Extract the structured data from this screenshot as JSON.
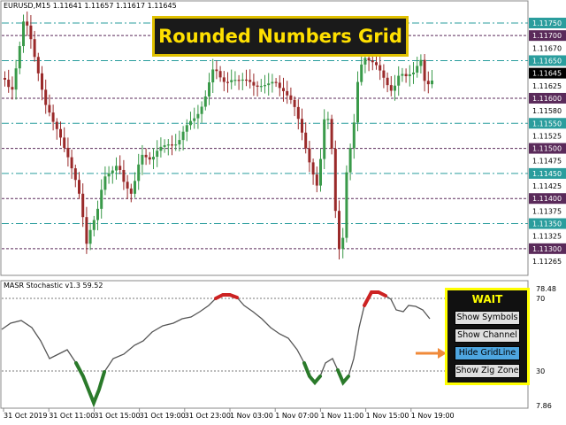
{
  "chart_title": "EURUSD,M15  1.11641 1.11657 1.11617 1.11645",
  "indicator_title": "MASR Stochastic v1.3 59.52",
  "banner": "Rounded Numbers Grid",
  "price_labels": [
    {
      "text": "1.11750",
      "style": "teal"
    },
    {
      "text": "1.11700",
      "style": "dark"
    },
    {
      "text": "1.11670",
      "style": "plain"
    },
    {
      "text": "1.11650",
      "style": "teal"
    },
    {
      "text": "1.11645",
      "style": "black"
    },
    {
      "text": "1.11625",
      "style": "plain"
    },
    {
      "text": "1.11600",
      "style": "dark"
    },
    {
      "text": "1.11580",
      "style": "plain"
    },
    {
      "text": "1.11550",
      "style": "teal"
    },
    {
      "text": "1.11525",
      "style": "plain"
    },
    {
      "text": "1.11500",
      "style": "dark"
    },
    {
      "text": "1.11475",
      "style": "plain"
    },
    {
      "text": "1.11450",
      "style": "teal"
    },
    {
      "text": "1.11425",
      "style": "plain"
    },
    {
      "text": "1.11400",
      "style": "dark"
    },
    {
      "text": "1.11375",
      "style": "plain"
    },
    {
      "text": "1.11350",
      "style": "teal"
    },
    {
      "text": "1.11325",
      "style": "plain"
    },
    {
      "text": "1.11300",
      "style": "dark"
    },
    {
      "text": "1.11265",
      "style": "plain"
    }
  ],
  "indicator_labels": [
    "78.48",
    "70",
    "30",
    "7.86"
  ],
  "time_labels": [
    "31 Oct 2019",
    "31 Oct 11:00",
    "31 Oct 15:00",
    "31 Oct 19:00",
    "31 Oct 23:00",
    "1 Nov 03:00",
    "1 Nov 07:00",
    "1 Nov 11:00",
    "1 Nov 15:00",
    "1 Nov 19:00"
  ],
  "colors": {
    "teal": "#2a9d9d",
    "dark": "#5a2a5a",
    "bull": "#3a9a4a",
    "bear": "#9a2a2a",
    "stoch": "#555555",
    "over": "#cc2222",
    "under": "#2a7a2a"
  },
  "panel": {
    "title": "WAIT",
    "buttons": [
      {
        "label": "Show Symbols",
        "active": false
      },
      {
        "label": "Show Channel",
        "active": false
      },
      {
        "label": "Hide GridLine",
        "active": true
      },
      {
        "label": "Show Zig Zone",
        "active": false
      }
    ]
  }
}
